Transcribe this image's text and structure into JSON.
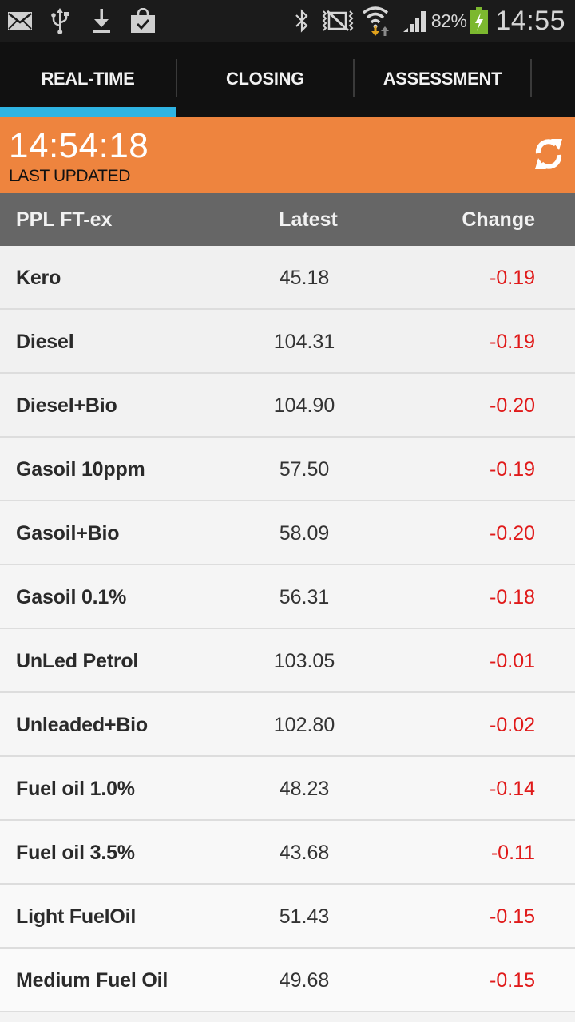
{
  "status_bar": {
    "left_icons": [
      "mail-icon",
      "usb-icon",
      "download-icon",
      "store-bag-icon"
    ],
    "right_icons": [
      "bluetooth-icon",
      "vibrate-mute-icon",
      "wifi-icon",
      "signal-icon",
      "battery-charging-icon"
    ],
    "battery_percent": "82%",
    "time": "14:55",
    "battery_color": "#7cb82f"
  },
  "tabs": [
    {
      "label": "REAL-TIME",
      "selected": true
    },
    {
      "label": "CLOSING",
      "selected": false
    },
    {
      "label": "ASSESSMENT",
      "selected": false
    }
  ],
  "update_panel": {
    "time": "14:54:18",
    "label": "LAST UPDATED",
    "refresh_icon": "refresh-icon",
    "background": "#ee843e"
  },
  "columns": {
    "name": "PPL FT-ex",
    "latest": "Latest",
    "change": "Change"
  },
  "rows": [
    {
      "name": "Kero",
      "latest": "45.18",
      "change": "-0.19"
    },
    {
      "name": "Diesel",
      "latest": "104.31",
      "change": "-0.19"
    },
    {
      "name": "Diesel+Bio",
      "latest": "104.90",
      "change": "-0.20"
    },
    {
      "name": "Gasoil 10ppm",
      "latest": "57.50",
      "change": "-0.19"
    },
    {
      "name": "Gasoil+Bio",
      "latest": "58.09",
      "change": "-0.20"
    },
    {
      "name": "Gasoil 0.1%",
      "latest": "56.31",
      "change": "-0.18"
    },
    {
      "name": "UnLed Petrol",
      "latest": "103.05",
      "change": "-0.01"
    },
    {
      "name": "Unleaded+Bio",
      "latest": "102.80",
      "change": "-0.02"
    },
    {
      "name": "Fuel oil 1.0%",
      "latest": "48.23",
      "change": "-0.14"
    },
    {
      "name": "Fuel oil 3.5%",
      "latest": "43.68",
      "change": "-0.11"
    },
    {
      "name": "Light FuelOil",
      "latest": "51.43",
      "change": "-0.15"
    },
    {
      "name": "Medium Fuel Oil",
      "latest": "49.68",
      "change": "-0.15"
    }
  ],
  "colors": {
    "accent_tab_indicator": "#2fb4e3",
    "negative_change": "#e01a1a",
    "header_gray": "#666666"
  }
}
